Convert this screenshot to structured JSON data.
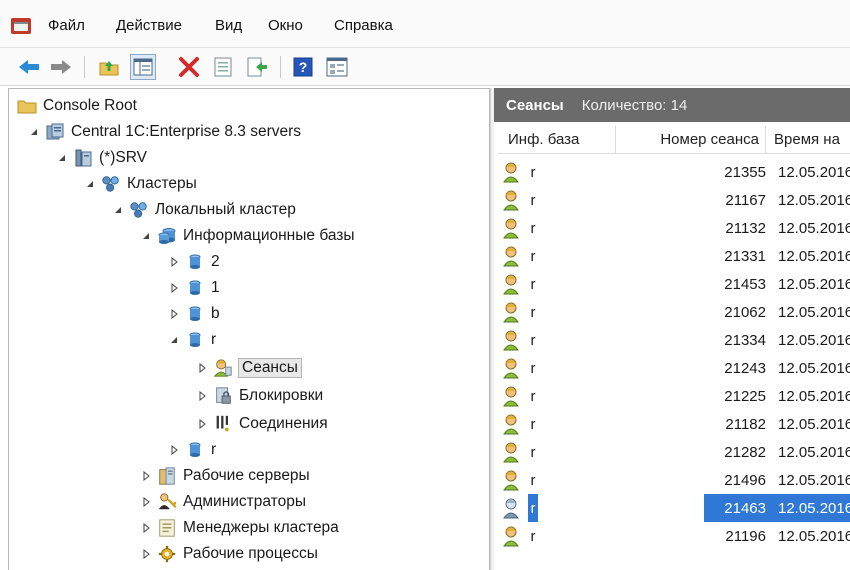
{
  "menu": {
    "items": [
      "Файл",
      "Действие",
      "Вид",
      "Окно",
      "Справка"
    ]
  },
  "toolbar": {
    "buttons": [
      "back-icon",
      "forward-icon",
      "up-folder-icon",
      "show-hide-tree-icon",
      "delete-icon",
      "properties-icon",
      "export-icon",
      "help-icon",
      "details-view-icon"
    ]
  },
  "tree": {
    "root": "Console Root",
    "central": "Central 1C:Enterprise 8.3 servers",
    "srv": "(*)SRV",
    "clusters": "Кластеры",
    "local_cluster": "Локальный кластер",
    "infobases": "Информационные базы",
    "db_2": "2",
    "db_1": "1",
    "db_b": "b",
    "db_r": "r",
    "sessions": "Сеансы",
    "locks": "Блокировки",
    "connections": "Соединения",
    "db_r2": "r",
    "work_servers": "Рабочие серверы",
    "admins": "Администраторы",
    "cluster_managers": "Менеджеры кластера",
    "work_processes": "Рабочие процессы"
  },
  "result": {
    "title": "Сеансы",
    "count": "Количество: 14",
    "columns": {
      "infobase": "Инф. база",
      "session_number": "Номер сеанса",
      "start_time": "Время на"
    },
    "rows": [
      {
        "db": "r",
        "id": "21355",
        "time": "12.05.2016"
      },
      {
        "db": "r",
        "id": "21167",
        "time": "12.05.2016"
      },
      {
        "db": "r",
        "id": "21132",
        "time": "12.05.2016"
      },
      {
        "db": "r",
        "id": "21331",
        "time": "12.05.2016"
      },
      {
        "db": "r",
        "id": "21453",
        "time": "12.05.2016"
      },
      {
        "db": "r",
        "id": "21062",
        "time": "12.05.2016"
      },
      {
        "db": "r",
        "id": "21334",
        "time": "12.05.2016"
      },
      {
        "db": "r",
        "id": "21243",
        "time": "12.05.2016"
      },
      {
        "db": "r",
        "id": "21225",
        "time": "12.05.2016"
      },
      {
        "db": "r",
        "id": "21182",
        "time": "12.05.2016"
      },
      {
        "db": "r",
        "id": "21282",
        "time": "12.05.2016"
      },
      {
        "db": "r",
        "id": "21496",
        "time": "12.05.2016"
      },
      {
        "db": "r",
        "id": "21463",
        "time": "12.05.2016"
      },
      {
        "db": "r",
        "id": "21196",
        "time": "12.05.2016"
      }
    ],
    "selected_index": 12
  },
  "colors": {
    "header_bg": "#6b6b6b",
    "selection": "#2f78d6",
    "folder": "#e8c45a"
  }
}
